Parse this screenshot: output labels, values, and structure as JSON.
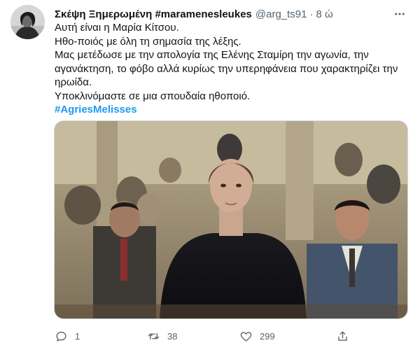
{
  "tweet": {
    "display_name": "Σκέψη Ξημερωμένη #maramenesleukes",
    "handle": "@arg_ts91",
    "separator": "·",
    "time": "8 ώ",
    "lines": [
      "Αυτή είναι η Μαρία Κίτσου.",
      "Ηθο-ποιός με όλη τη σημασία της λέξης.",
      "Μας μετέδωσε με την απολογία της Ελένης Σταμίρη την αγωνία, την αγανάκτηση, το φόβο αλλά κυρίως την υπερηφάνεια που χαρακτηρίζει την ηρωίδα.",
      "Υποκλινόμαστε σε μια σπουδαία ηθοποιό."
    ],
    "hashtag": "#AgriesMelisses",
    "counts": {
      "replies": "1",
      "retweets": "38",
      "likes": "299"
    }
  },
  "icons": {
    "more": "more-dots-icon",
    "reply": "reply-icon",
    "retweet": "retweet-icon",
    "like": "heart-icon",
    "share": "share-icon"
  },
  "colors": {
    "link": "#1d9bf0",
    "secondary_text": "#536471",
    "primary_text": "#0f1419"
  }
}
